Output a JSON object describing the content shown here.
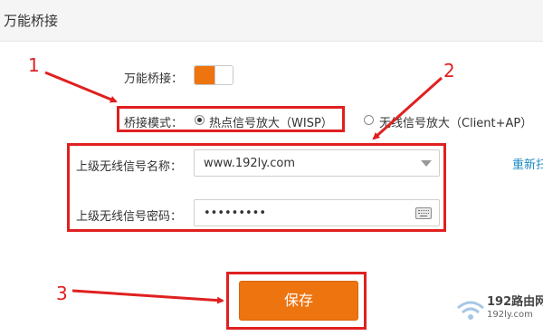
{
  "header": {
    "title": "万能桥接"
  },
  "bridge": {
    "label": "万能桥接：",
    "enabled": true
  },
  "mode": {
    "label": "桥接模式：",
    "options": [
      {
        "label": "热点信号放大（WISP）",
        "selected": true
      },
      {
        "label": "无线信号放大（Client+AP）",
        "selected": false
      }
    ]
  },
  "upstream": {
    "ssid_label": "上级无线信号名称：",
    "ssid_value": "www.192ly.com",
    "password_label": "上级无线信号密码：",
    "password_value": "•••••••••",
    "refresh_label": "重新扫"
  },
  "actions": {
    "save_label": "保存"
  },
  "annotations": {
    "n1": "1",
    "n2": "2",
    "n3": "3",
    "color": "#e02020"
  },
  "watermark": {
    "title": "192路由网",
    "url": "192ly.com"
  },
  "colors": {
    "accent": "#ee7410",
    "link": "#1e8bc3"
  }
}
